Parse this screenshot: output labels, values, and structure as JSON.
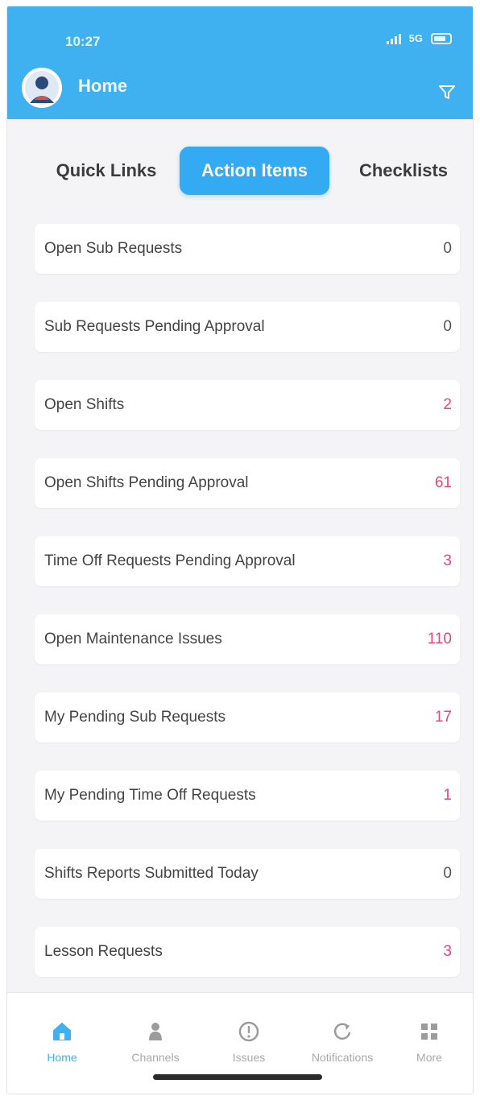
{
  "status_bar": {
    "time": "10:27",
    "network": "5G"
  },
  "header": {
    "title": "Home"
  },
  "tabs": [
    {
      "label": "Quick Links"
    },
    {
      "label": "Action Items",
      "active": true
    },
    {
      "label": "Checklists"
    }
  ],
  "action_items": [
    {
      "label": "Open Sub Requests",
      "count": "0",
      "alert": false
    },
    {
      "label": "Sub Requests Pending Approval",
      "count": "0",
      "alert": false
    },
    {
      "label": "Open Shifts",
      "count": "2",
      "alert": true
    },
    {
      "label": "Open Shifts Pending Approval",
      "count": "61",
      "alert": true
    },
    {
      "label": "Time Off Requests Pending Approval",
      "count": "3",
      "alert": true
    },
    {
      "label": "Open Maintenance Issues",
      "count": "110",
      "alert": true
    },
    {
      "label": "My Pending Sub Requests",
      "count": "17",
      "alert": true
    },
    {
      "label": "My Pending Time Off Requests",
      "count": "1",
      "alert": true
    },
    {
      "label": "Shifts Reports Submitted Today",
      "count": "0",
      "alert": false
    },
    {
      "label": "Lesson Requests",
      "count": "3",
      "alert": true
    }
  ],
  "bottom_nav": [
    {
      "label": "Home",
      "icon": "home-icon",
      "active": true
    },
    {
      "label": "Channels",
      "icon": "person-icon"
    },
    {
      "label": "Issues",
      "icon": "alert-circle-icon"
    },
    {
      "label": "Notifications",
      "icon": "refresh-icon"
    },
    {
      "label": "More",
      "icon": "grid-icon"
    }
  ],
  "colors": {
    "header": "#3fb0f0",
    "accent": "#33aaf1",
    "alert": "#e8457a"
  }
}
